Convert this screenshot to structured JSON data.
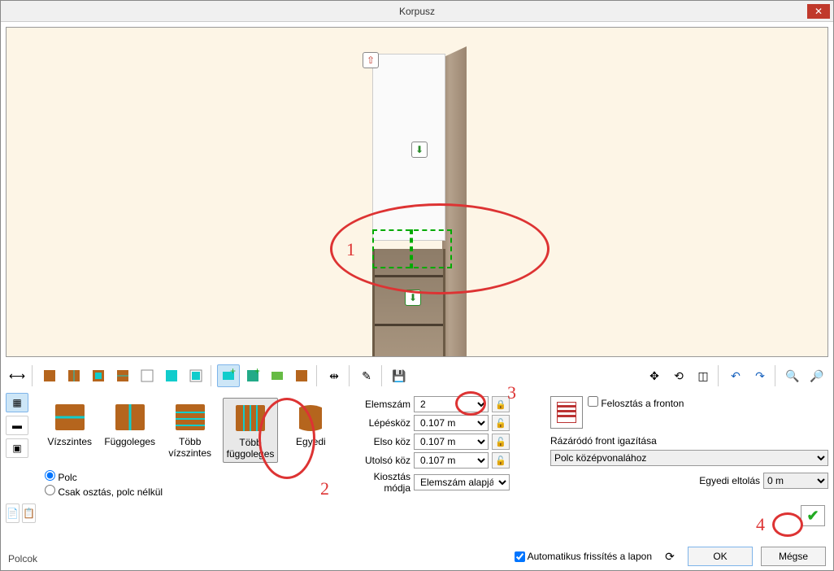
{
  "window": {
    "title": "Korpusz"
  },
  "annotations": {
    "n1": "1",
    "n2": "2",
    "n3": "3",
    "n4": "4"
  },
  "gallery": {
    "items": [
      {
        "label": "Vízszintes"
      },
      {
        "label": "Függoleges"
      },
      {
        "label": "Több vízszintes"
      },
      {
        "label": "Több függoleges"
      },
      {
        "label": "Egyedi"
      }
    ]
  },
  "radio": {
    "shelf": "Polc",
    "divonly": "Csak osztás, polc nélkül"
  },
  "params": {
    "count_label": "Elemszám",
    "count_value": "2",
    "step_label": "Lépésköz",
    "step_value": "0.107 m",
    "first_label": "Elso köz",
    "first_value": "0.107 m",
    "last_label": "Utolsó köz",
    "last_value": "0.107 m",
    "mode_label": "Kiosztás módja",
    "mode_value": "Elemszám alapján"
  },
  "right": {
    "split_front": "Felosztás a fronton",
    "align_label": "Rázáródó front igazítása",
    "align_value": "Polc középvonalához",
    "offset_label": "Egyedi eltolás",
    "offset_value": "0 m"
  },
  "bottom": {
    "auto_update": "Automatikus frissítés a lapon",
    "ok": "OK",
    "cancel": "Mégse"
  },
  "section": {
    "label": "Polcok"
  }
}
